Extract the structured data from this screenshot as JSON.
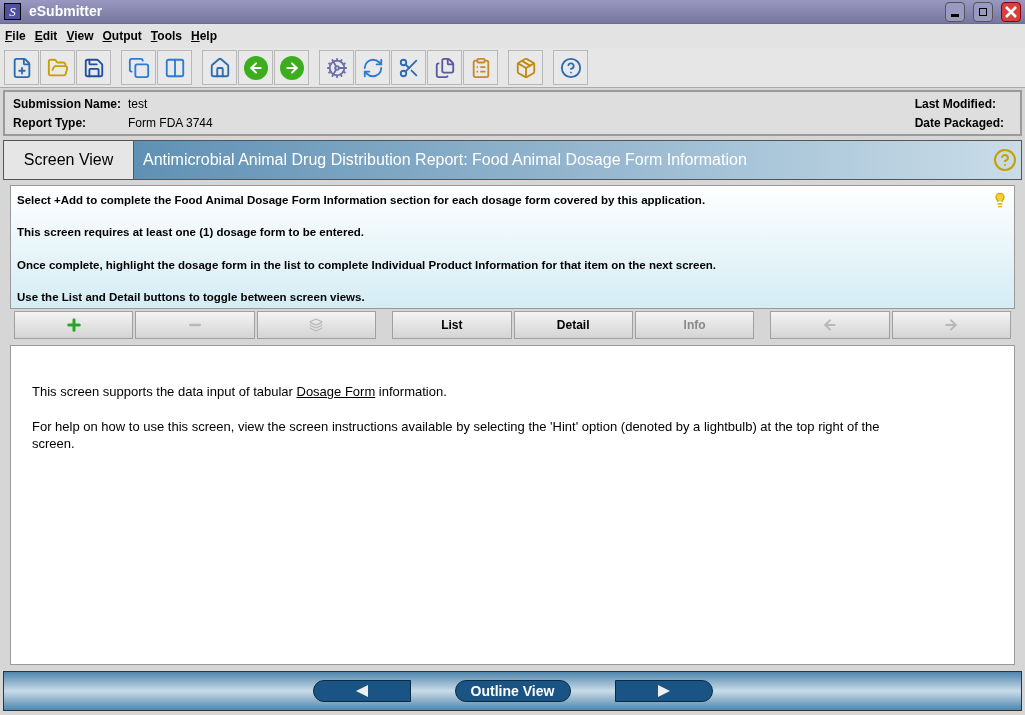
{
  "window": {
    "logo": "S",
    "title": "eSubmitter"
  },
  "menu": [
    "File",
    "Edit",
    "View",
    "Output",
    "Tools",
    "Help"
  ],
  "submission": {
    "name_label": "Submission Name:",
    "name_value": "test",
    "type_label": "Report Type:",
    "type_value": "Form FDA 3744",
    "modified_label": "Last Modified:",
    "packaged_label": "Date Packaged:"
  },
  "header": {
    "view_label": "Screen View",
    "title": "Antimicrobial Animal Drug Distribution Report: Food Animal Dosage Form Information"
  },
  "hints": [
    "Select +Add to complete the Food Animal Dosage Form Information section for each dosage form covered by this application.",
    "This screen requires at least one (1) dosage form to be entered.",
    "Once complete, highlight the dosage form in the list to complete Individual Product Information for that item on the next screen.",
    "Use the List and Detail buttons to toggle between screen views."
  ],
  "actions": [
    {
      "kind": "add",
      "disabled": false
    },
    {
      "kind": "remove",
      "disabled": true
    },
    {
      "kind": "copy",
      "disabled": true
    },
    {
      "kind": "text",
      "label": "List",
      "disabled": false
    },
    {
      "kind": "text",
      "label": "Detail",
      "disabled": false
    },
    {
      "kind": "text",
      "label": "Info",
      "disabled": true
    },
    {
      "kind": "prev",
      "disabled": true
    },
    {
      "kind": "next",
      "disabled": true
    }
  ],
  "content": {
    "intro_before": "This screen supports the data input of tabular ",
    "intro_link": "Dosage Form",
    "intro_after": " information.",
    "help": "For help on how to use this screen, view the screen instructions available by selecting the 'Hint' option (denoted by a lightbulb) at the top right of the screen."
  },
  "footer": {
    "outline_label": "Outline View"
  }
}
